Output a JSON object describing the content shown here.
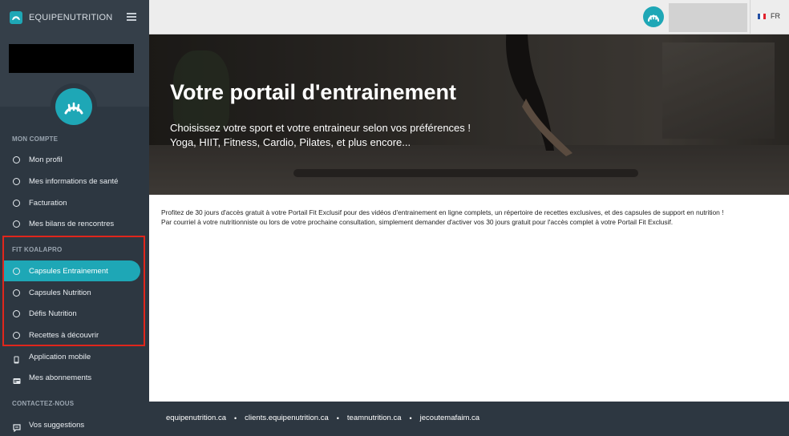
{
  "brand": {
    "name": "EQUIPENUTRITION",
    "accent": "#1ea7b6"
  },
  "sidebar": {
    "sections": [
      {
        "label": "MON COMPTE",
        "items": [
          {
            "label": "Mon profil",
            "icon": "circle-icon"
          },
          {
            "label": "Mes informations de santé",
            "icon": "circle-icon"
          },
          {
            "label": "Facturation",
            "icon": "circle-icon"
          },
          {
            "label": "Mes bilans de rencontres",
            "icon": "circle-icon"
          }
        ]
      },
      {
        "label": "FIT KOALAPRO",
        "items": [
          {
            "label": "Capsules Entrainement",
            "icon": "circle-icon",
            "active": true
          },
          {
            "label": "Capsules Nutrition",
            "icon": "circle-icon"
          },
          {
            "label": "Défis Nutrition",
            "icon": "circle-icon"
          },
          {
            "label": "Recettes à découvrir",
            "icon": "circle-icon"
          }
        ]
      },
      {
        "label": "",
        "items": [
          {
            "label": "Application mobile",
            "icon": "mobile-icon"
          },
          {
            "label": "Mes abonnements",
            "icon": "card-icon"
          }
        ]
      },
      {
        "label": "CONTACTEZ-NOUS",
        "items": [
          {
            "label": "Vos suggestions",
            "icon": "feedback-icon"
          }
        ]
      }
    ]
  },
  "topbar": {
    "language": "FR"
  },
  "hero": {
    "title": "Votre portail d'entrainement",
    "subtitle_line1": "Choisissez votre sport et votre entraineur selon vos préférences !",
    "subtitle_line2": "Yoga, HIIT, Fitness, Cardio, Pilates, et plus encore..."
  },
  "main": {
    "paragraph1": "Profitez de 30 jours d'accès gratuit à votre Portail Fit Exclusif pour des vidéos d'entrainement en ligne complets, un répertoire de recettes exclusives, et des capsules de support en nutrition !",
    "paragraph2": "Par courriel à votre nutritionniste ou lors de votre prochaine consultation, simplement demander d'activer vos 30 jours gratuit pour l'accès complet à votre Portail Fit Exclusif."
  },
  "footer": {
    "links": [
      "equipenutrition.ca",
      "clients.equipenutrition.ca",
      "teamnutrition.ca",
      "jecoutemafaim.ca"
    ]
  }
}
